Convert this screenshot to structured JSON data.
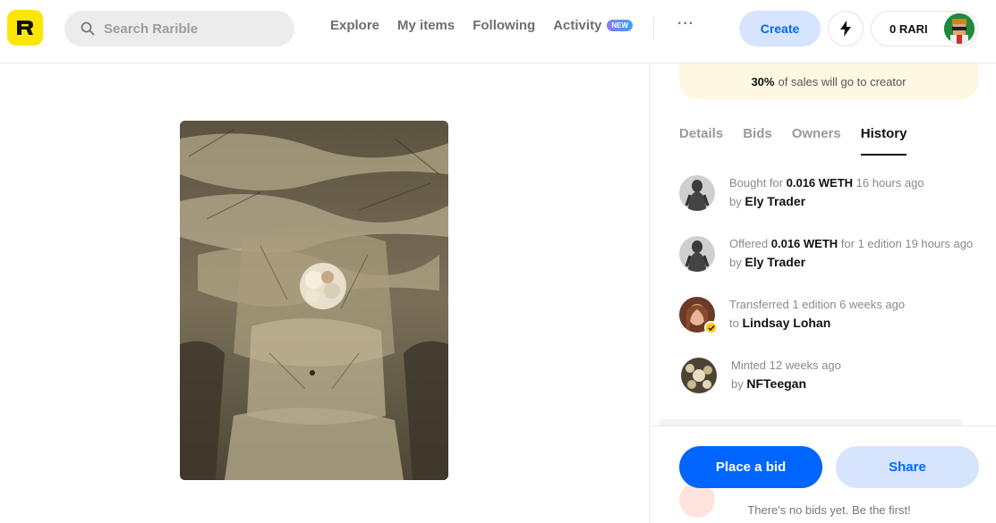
{
  "header": {
    "search_placeholder": "Search Rarible",
    "nav": [
      "Explore",
      "My items",
      "Following",
      "Activity"
    ],
    "activity_badge": "NEW",
    "more_label": "···",
    "create_label": "Create",
    "wallet_label": "0 RARI"
  },
  "royalty": {
    "percent": "30%",
    "text": "of sales will go to creator"
  },
  "tabs": [
    "Details",
    "Bids",
    "Owners",
    "History"
  ],
  "active_tab": "History",
  "history": [
    {
      "action": "Bought for",
      "amount": "0.016 WETH",
      "suffix": "16 hours ago",
      "prep": "by",
      "user": "Ely Trader"
    },
    {
      "action": "Offered",
      "amount": "0.016 WETH",
      "suffix": "for 1 edition 19 hours ago",
      "prep": "by",
      "user": "Ely Trader"
    },
    {
      "action": "Transferred 1 edition 6 weeks ago",
      "amount": "",
      "suffix": "",
      "prep": "to",
      "user": "Lindsay Lohan"
    },
    {
      "action": "Minted 12 weeks ago",
      "amount": "",
      "suffix": "",
      "prep": "by",
      "user": "NFTeegan"
    }
  ],
  "actions": {
    "place_bid": "Place a bid",
    "share": "Share",
    "no_bids": "There's no bids yet. Be the first!"
  },
  "colors": {
    "brand_yellow": "#fee603",
    "primary_blue": "#0066ff",
    "light_blue": "#d6e5fd"
  }
}
